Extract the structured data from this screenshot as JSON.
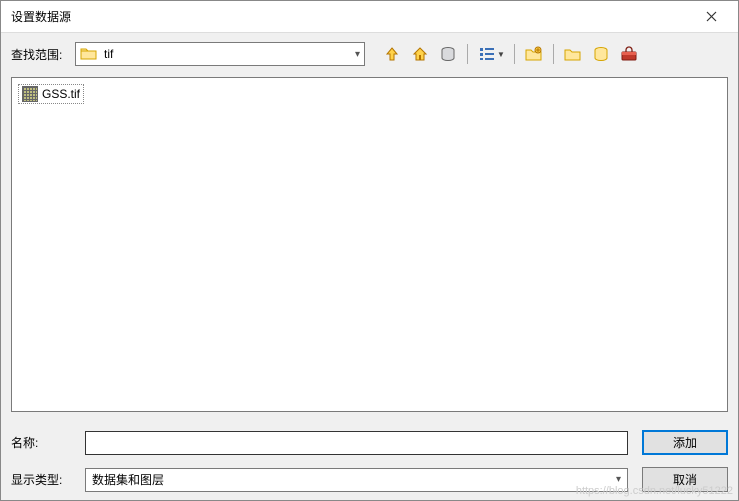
{
  "titlebar": {
    "title": "设置数据源"
  },
  "lookin": {
    "label": "查找范围:",
    "folder": "tif"
  },
  "file": {
    "name": "GSS.tif"
  },
  "name_row": {
    "label": "名称:",
    "value": ""
  },
  "type_row": {
    "label": "显示类型:",
    "selected": "数据集和图层"
  },
  "buttons": {
    "add": "添加",
    "cancel": "取消"
  },
  "watermark": "https://blog.csdn.net/lucky51222"
}
